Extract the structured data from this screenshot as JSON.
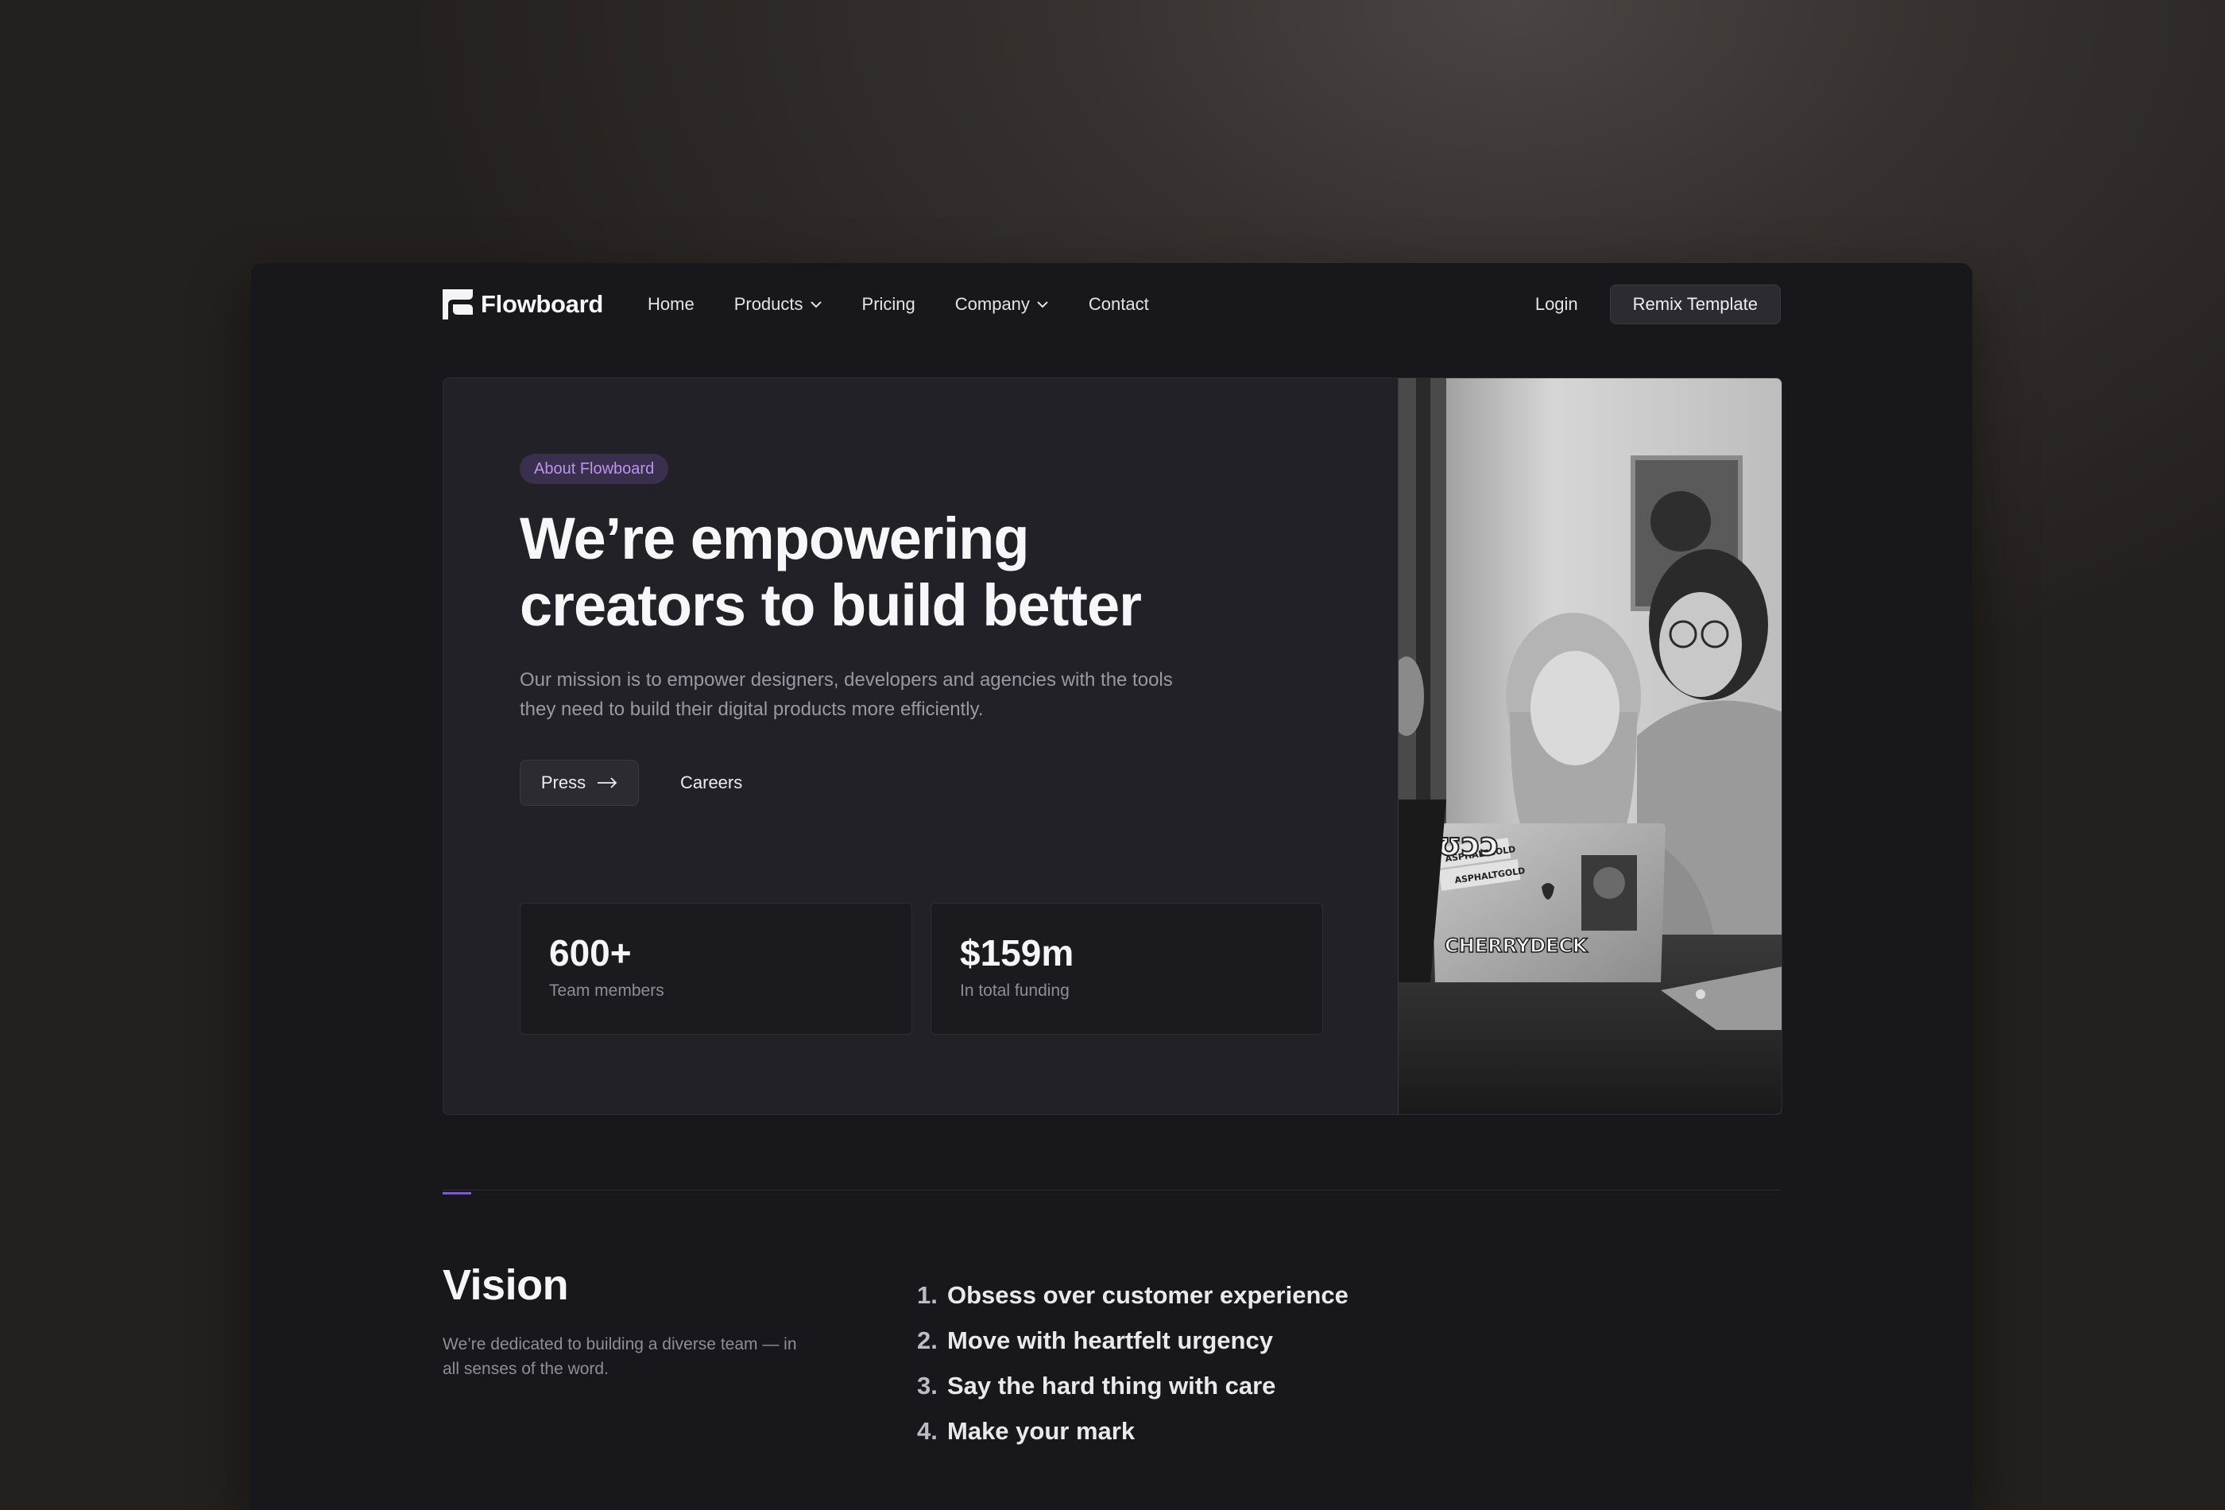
{
  "nav": {
    "brand": "Flowboard",
    "links": [
      {
        "label": "Home",
        "dropdown": false
      },
      {
        "label": "Products",
        "dropdown": true
      },
      {
        "label": "Pricing",
        "dropdown": false
      },
      {
        "label": "Company",
        "dropdown": true
      },
      {
        "label": "Contact",
        "dropdown": false
      }
    ],
    "login": "Login",
    "cta": "Remix Template"
  },
  "hero": {
    "badge": "About Flowboard",
    "headline_line1": "We’re empowering",
    "headline_line2": "creators to build better",
    "subtext": "Our mission is to empower designers, developers and agencies with the tools they need to build their digital products more efficiently.",
    "primary_button": "Press",
    "secondary_link": "Careers",
    "stats": [
      {
        "value": "600+",
        "label": "Team members"
      },
      {
        "value": "$159m",
        "label": "In total funding"
      }
    ],
    "photo": {
      "laptop_sticker_1": "ASPHALTGOLD",
      "laptop_sticker_2": "ASPHALTGOLD",
      "laptop_brand": "CHERRYDECK",
      "sticker_large": "ʊɔɔ"
    }
  },
  "vision": {
    "title": "Vision",
    "text": "We’re dedicated to building a diverse team — in all senses of the word.",
    "values": [
      {
        "num": "1.",
        "text": "Obsess over customer experience"
      },
      {
        "num": "2.",
        "text": "Move with heartfelt urgency"
      },
      {
        "num": "3.",
        "text": "Say the hard thing with care"
      },
      {
        "num": "4.",
        "text": "Make your mark"
      }
    ]
  },
  "colors": {
    "accent": "#7d5bc8",
    "badge_text": "#b995ee",
    "window_bg": "#18171c",
    "card_bg": "#222127"
  }
}
